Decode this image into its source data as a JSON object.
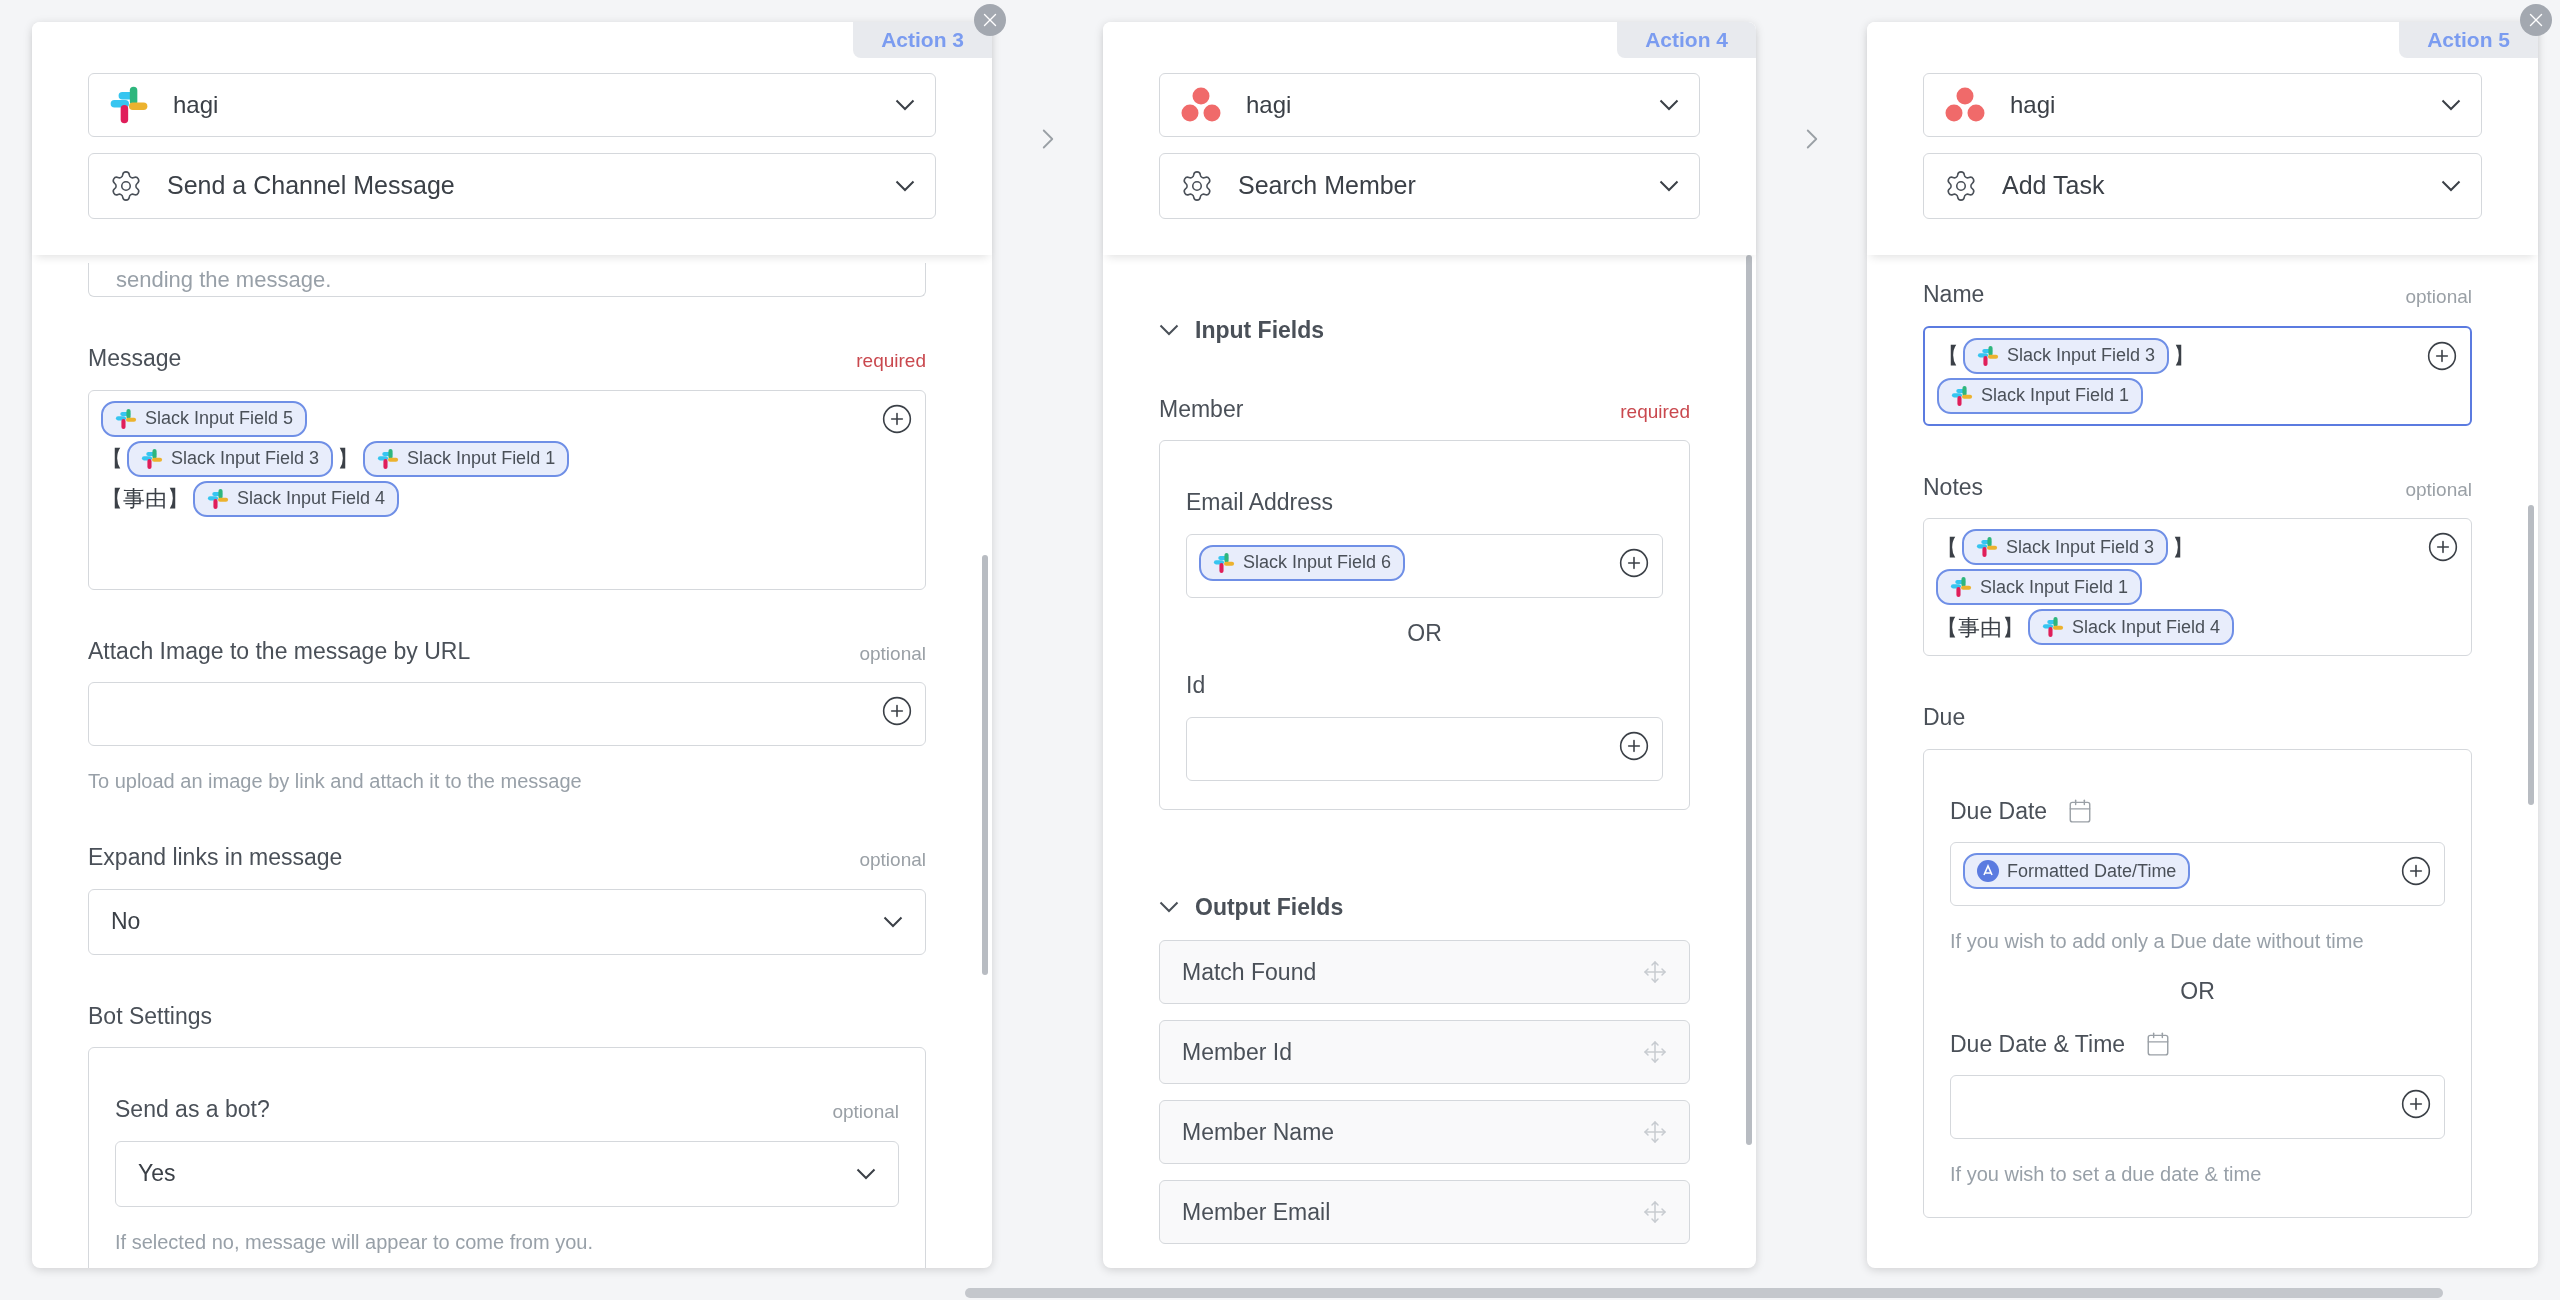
{
  "panels": [
    {
      "action_tag": "Action 3",
      "closable": true,
      "app": {
        "kind": "slack",
        "name": "hagi"
      },
      "operation": "Send a Channel Message",
      "items": [
        {
          "kind": "partial",
          "text": "sending the message."
        },
        {
          "kind": "textarea",
          "label": "Message",
          "badge": {
            "kind": "required",
            "text": "required"
          },
          "focused": false,
          "lines": [
            [
              {
                "kind": "slack_chip",
                "label": "Slack Input Field 5"
              }
            ],
            [
              {
                "kind": "text",
                "text": "【"
              },
              {
                "kind": "slack_chip",
                "label": "Slack Input Field 3"
              },
              {
                "kind": "text",
                "text": "】"
              },
              {
                "kind": "slack_chip",
                "label": "Slack Input Field 1"
              }
            ],
            [
              {
                "kind": "text",
                "text": "【事由】"
              },
              {
                "kind": "slack_chip",
                "label": "Slack Input Field 4"
              }
            ]
          ]
        },
        {
          "kind": "field",
          "label": "Attach Image to the message by URL",
          "badge": {
            "kind": "optional",
            "text": "optional"
          },
          "focused": false,
          "hint": "To upload an image by link and attach it to the message"
        },
        {
          "kind": "select",
          "label": "Expand links in message",
          "badge": {
            "kind": "optional",
            "text": "optional"
          },
          "value": "No"
        },
        {
          "kind": "group",
          "label": "Bot Settings",
          "children": [
            {
              "kind": "select",
              "label": "Send as a bot?",
              "badge": {
                "kind": "optional",
                "text": "optional"
              },
              "value": "Yes",
              "hint": "If selected no, message will appear to come from you."
            }
          ]
        }
      ]
    },
    {
      "action_tag": "Action 4",
      "closable": false,
      "app": {
        "kind": "asana",
        "name": "hagi"
      },
      "operation": "Search Member",
      "items": [
        {
          "kind": "section",
          "title": "Input Fields",
          "expanded": true
        },
        {
          "kind": "group",
          "label": "Member",
          "badge": {
            "kind": "required",
            "text": "required"
          },
          "children": [
            {
              "kind": "field",
              "label": "Email Address",
              "focused": false,
              "lines": [
                [
                  {
                    "kind": "slack_chip",
                    "label": "Slack Input Field 6"
                  }
                ]
              ]
            },
            {
              "kind": "or",
              "text": "OR"
            },
            {
              "kind": "field",
              "label": "Id",
              "focused": false
            }
          ]
        },
        {
          "kind": "section",
          "title": "Output Fields",
          "expanded": true
        },
        {
          "kind": "output",
          "label": "Match Found"
        },
        {
          "kind": "output",
          "label": "Member Id"
        },
        {
          "kind": "output",
          "label": "Member Name"
        },
        {
          "kind": "output",
          "label": "Member Email"
        }
      ]
    },
    {
      "action_tag": "Action 5",
      "closable": true,
      "app": {
        "kind": "asana",
        "name": "hagi"
      },
      "operation": "Add Task",
      "items": [
        {
          "kind": "field",
          "label": "Name",
          "badge": {
            "kind": "optional",
            "text": "optional"
          },
          "focused": true,
          "lines": [
            [
              {
                "kind": "text",
                "text": "【"
              },
              {
                "kind": "slack_chip",
                "label": "Slack Input Field 3"
              },
              {
                "kind": "text",
                "text": "】"
              }
            ],
            [
              {
                "kind": "slack_chip",
                "label": "Slack Input Field 1"
              }
            ]
          ]
        },
        {
          "kind": "field",
          "label": "Notes",
          "badge": {
            "kind": "optional",
            "text": "optional"
          },
          "focused": false,
          "lines": [
            [
              {
                "kind": "text",
                "text": "【"
              },
              {
                "kind": "slack_chip",
                "label": "Slack Input Field 3"
              },
              {
                "kind": "text",
                "text": "】"
              }
            ],
            [
              {
                "kind": "slack_chip",
                "label": "Slack Input Field 1"
              }
            ],
            [
              {
                "kind": "text",
                "text": "【事由】"
              },
              {
                "kind": "slack_chip",
                "label": "Slack Input Field 4"
              }
            ]
          ]
        },
        {
          "kind": "group",
          "label": "Due",
          "children": [
            {
              "kind": "date_field",
              "label": "Due Date",
              "focused": false,
              "lines": [
                [
                  {
                    "kind": "formatter_chip",
                    "label": "Formatted Date/Time"
                  }
                ]
              ],
              "hint": "If you wish to add only a Due date without time"
            },
            {
              "kind": "or",
              "text": "OR"
            },
            {
              "kind": "date_field",
              "label": "Due Date & Time",
              "focused": false,
              "hint": "If you wish to set a due date & time"
            }
          ]
        }
      ]
    }
  ]
}
